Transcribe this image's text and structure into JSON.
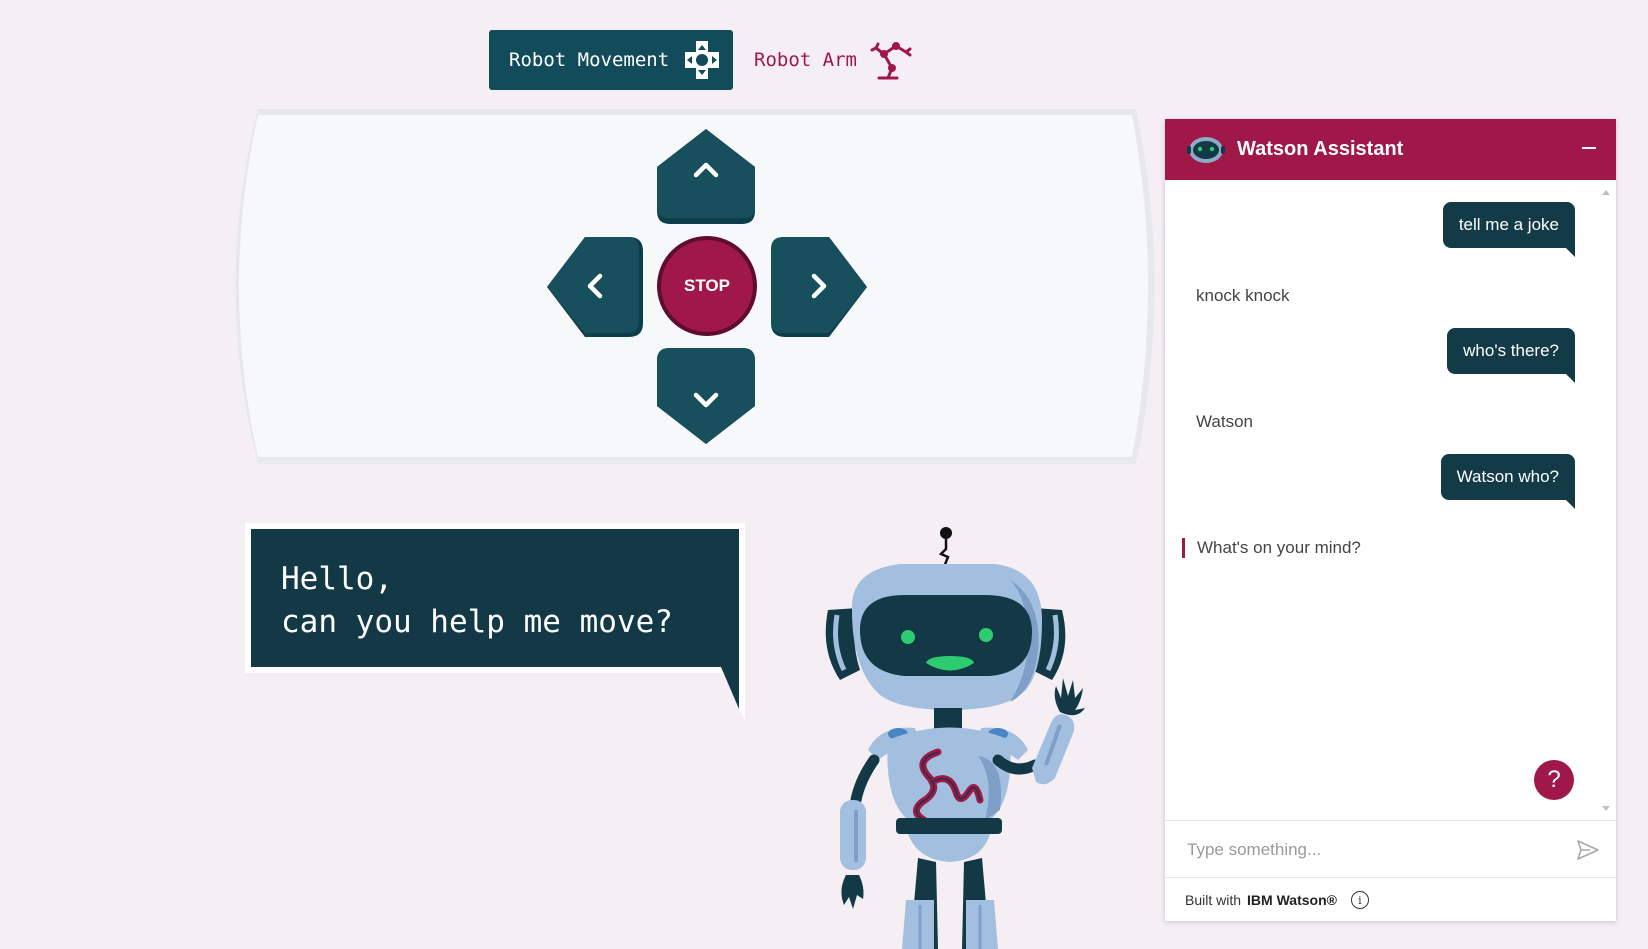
{
  "tabs": {
    "movement_label": "Robot Movement",
    "arm_label": "Robot Arm"
  },
  "controls": {
    "stop_label": "STOP"
  },
  "speech": {
    "text": "Hello,\ncan you help me move?"
  },
  "chat": {
    "title": "Watson Assistant",
    "messages": [
      {
        "from": "user",
        "text": "tell me a joke"
      },
      {
        "from": "bot",
        "text": "knock knock"
      },
      {
        "from": "user",
        "text": "who's there?"
      },
      {
        "from": "bot",
        "text": "Watson"
      },
      {
        "from": "user",
        "text": "Watson who?"
      },
      {
        "from": "bot",
        "text": "What's on your mind?"
      }
    ],
    "help_label": "?",
    "input_placeholder": "Type something...",
    "footer_prefix": "Built with",
    "footer_brand": "IBM Watson®"
  },
  "colors": {
    "teal": "#124b5a",
    "crimson": "#a01848",
    "background": "#f5eff3"
  }
}
